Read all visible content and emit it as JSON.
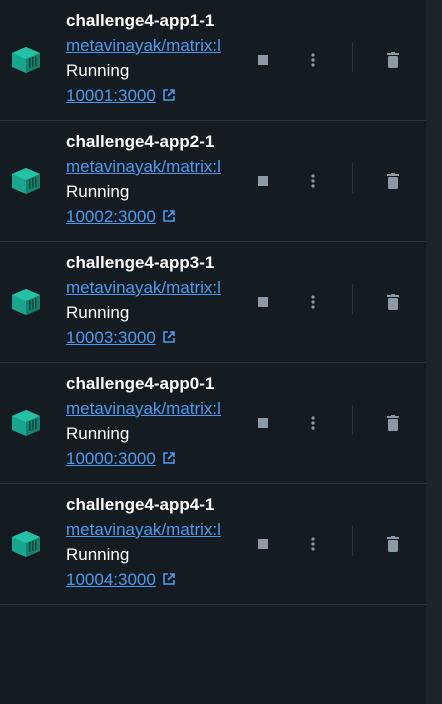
{
  "colors": {
    "background": "#151c21",
    "accent": "#4a9bf0",
    "icon_teal": "#1aa58e",
    "action_gray": "#8c9aa5"
  },
  "icons": {
    "container": "container-icon",
    "stop": "stop-icon",
    "more": "more-vertical-icon",
    "delete": "trash-icon",
    "external": "external-link-icon"
  },
  "containers": [
    {
      "name": "challenge4-app1-1",
      "image": "metavinayak/matrix:l",
      "status": "Running",
      "port": "10001:3000"
    },
    {
      "name": "challenge4-app2-1",
      "image": "metavinayak/matrix:l",
      "status": "Running",
      "port": "10002:3000"
    },
    {
      "name": "challenge4-app3-1",
      "image": "metavinayak/matrix:l",
      "status": "Running",
      "port": "10003:3000"
    },
    {
      "name": "challenge4-app0-1",
      "image": "metavinayak/matrix:l",
      "status": "Running",
      "port": "10000:3000"
    },
    {
      "name": "challenge4-app4-1",
      "image": "metavinayak/matrix:l",
      "status": "Running",
      "port": "10004:3000"
    }
  ]
}
